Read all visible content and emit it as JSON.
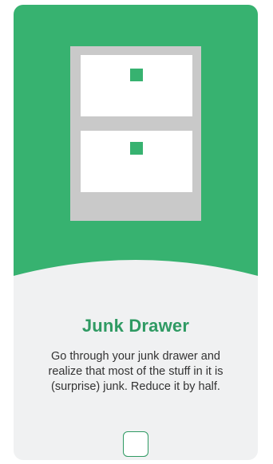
{
  "card": {
    "title": "Junk Drawer",
    "description": "Go through your junk drawer and realize that most of the stuff in it is (surprise) junk. Reduce it by half.",
    "illustration": "drawer-cabinet-icon",
    "checkbox": {
      "checked": false
    }
  },
  "colors": {
    "hero_green": "#37b270",
    "title_green": "#2f9a63",
    "card_background": "#f0f1f2",
    "cabinet_frame": "#c9c9c9",
    "drawer_face": "#ffffff",
    "drawer_handle": "#37b270"
  }
}
